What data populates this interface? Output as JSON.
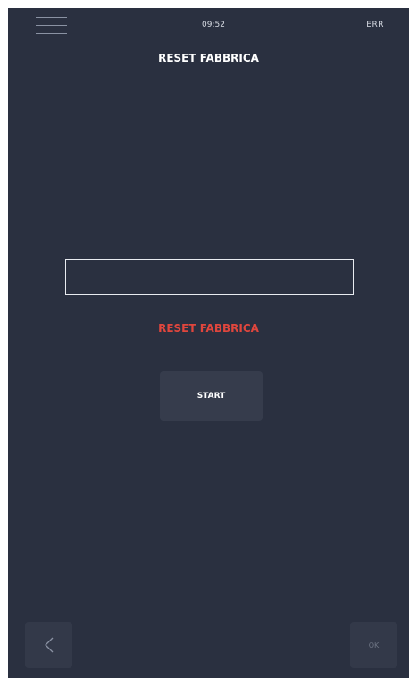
{
  "header": {
    "time": "09:52",
    "status": "ERR",
    "menu_icon": "hamburger-menu-icon"
  },
  "page": {
    "title": "RESET FABBRICA"
  },
  "main": {
    "input_value": "",
    "warning_text": "RESET FABBRICA",
    "start_label": "START"
  },
  "footer": {
    "back_icon": "chevron-left-icon",
    "ok_label": "OK"
  },
  "colors": {
    "background": "#2a3040",
    "button_background": "#363c4c",
    "warning": "#e0463d",
    "text": "#ffffff"
  }
}
